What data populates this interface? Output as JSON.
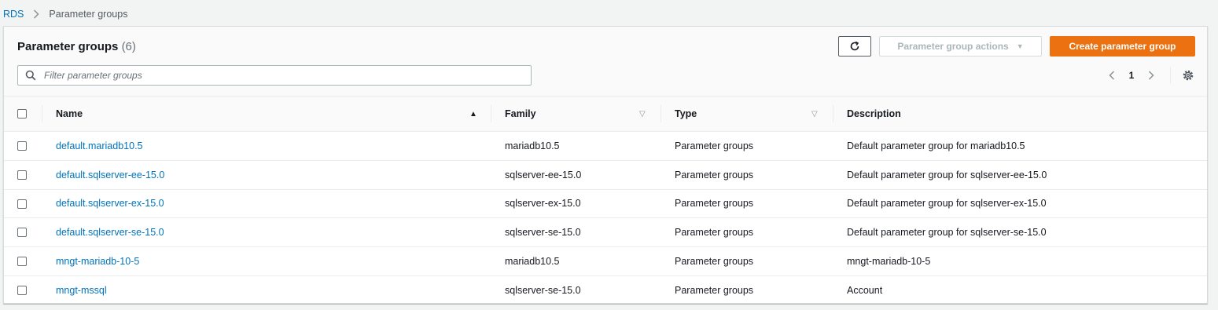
{
  "breadcrumb": {
    "root": "RDS",
    "current": "Parameter groups"
  },
  "header": {
    "title": "Parameter groups",
    "count": "(6)",
    "actions_label": "Parameter group actions",
    "create_label": "Create parameter group"
  },
  "search": {
    "placeholder": "Filter parameter groups",
    "value": ""
  },
  "pagination": {
    "current_page": "1"
  },
  "columns": {
    "name": "Name",
    "family": "Family",
    "type": "Type",
    "description": "Description"
  },
  "rows": [
    {
      "name": "default.mariadb10.5",
      "family": "mariadb10.5",
      "type": "Parameter groups",
      "description": "Default parameter group for mariadb10.5"
    },
    {
      "name": "default.sqlserver-ee-15.0",
      "family": "sqlserver-ee-15.0",
      "type": "Parameter groups",
      "description": "Default parameter group for sqlserver-ee-15.0"
    },
    {
      "name": "default.sqlserver-ex-15.0",
      "family": "sqlserver-ex-15.0",
      "type": "Parameter groups",
      "description": "Default parameter group for sqlserver-ex-15.0"
    },
    {
      "name": "default.sqlserver-se-15.0",
      "family": "sqlserver-se-15.0",
      "type": "Parameter groups",
      "description": "Default parameter group for sqlserver-se-15.0"
    },
    {
      "name": "mngt-mariadb-10-5",
      "family": "mariadb10.5",
      "type": "Parameter groups",
      "description": "mngt-mariadb-10-5"
    },
    {
      "name": "mngt-mssql",
      "family": "sqlserver-se-15.0",
      "type": "Parameter groups",
      "description": "Account"
    }
  ],
  "colors": {
    "accent": "#ec7211",
    "link": "#0073bb"
  },
  "icons": {
    "breadcrumb_separator": "chevron-right-icon",
    "refresh": "refresh-icon",
    "actions_caret": "caret-down-icon",
    "search": "search-icon",
    "prev": "chevron-left-icon",
    "next": "chevron-right-icon",
    "settings": "gear-icon"
  }
}
